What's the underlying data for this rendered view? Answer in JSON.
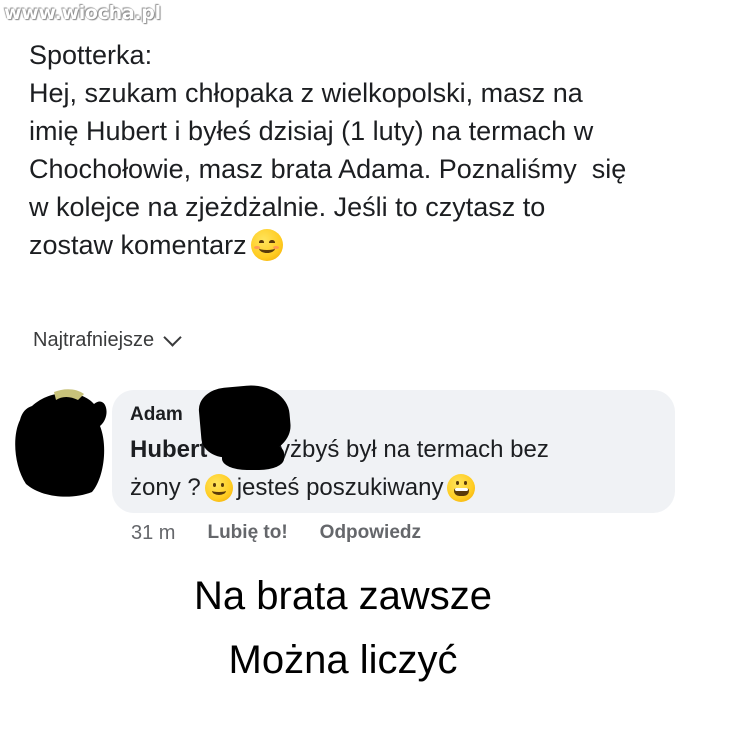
{
  "watermark": "www.wiocha.pl",
  "post": {
    "author": "Spotterka:",
    "lines": [
      "Hej, szukam chłopaka z wielkopolski, masz na",
      "imię Hubert i byłeś dzisiaj (1 luty) na termach w",
      "Chochołowie, masz brata Adama. Poznaliśmy  się",
      "w kolejce na zjeżdżalnie. Jeśli to czytasz to",
      "zostaw komentarz"
    ],
    "emoji": "smiling-face-with-smiling-eyes"
  },
  "sort": {
    "label": "Najtrafniejsze",
    "icon": "chevron-down-icon"
  },
  "comment": {
    "author": "Adam",
    "mention": "Hubert",
    "text_line1": "czyżbyś był na termach bez",
    "text_line2a": "żony ?",
    "text_line2b": "jesteś poszukiwany",
    "emoji1": "slightly-smiling-face",
    "emoji2": "grinning-face",
    "bubble_color": "#f0f2f5"
  },
  "actions": {
    "time": "31 m",
    "like": "Lubię to!",
    "reply": "Odpowiedz"
  },
  "caption": {
    "line1": "Na brata zawsze",
    "line2": "Można liczyć"
  }
}
